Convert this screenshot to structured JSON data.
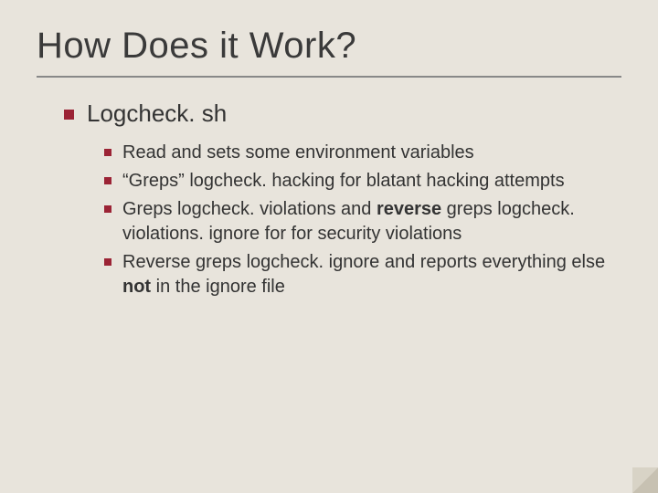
{
  "title": "How Does it Work?",
  "level1": {
    "text": "Logcheck. sh"
  },
  "level2": [
    {
      "text": "Read and sets some environment variables"
    },
    {
      "text": "“Greps” logcheck. hacking for blatant hacking attempts"
    },
    {
      "pre": "Greps logcheck. violations and ",
      "bold": "reverse",
      "post": " greps logcheck. violations. ignore for for security violations"
    },
    {
      "pre": "Reverse greps logcheck. ignore and reports everything else ",
      "bold": "not",
      "post": " in the ignore file"
    }
  ]
}
